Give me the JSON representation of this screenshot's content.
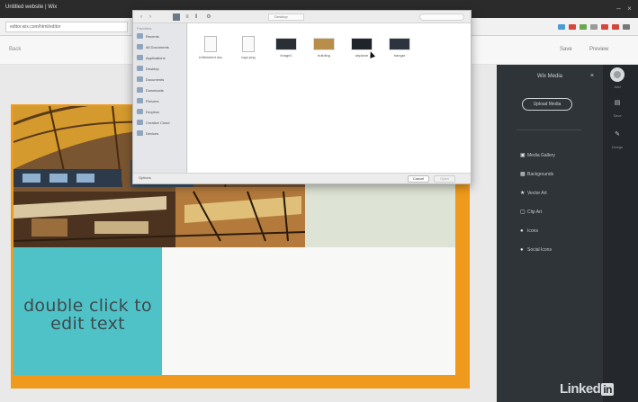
{
  "browser": {
    "window_title": "Untitled website | Wix",
    "url": "editor.wix.com/html/editor",
    "back": "Back",
    "toolbar_right": [
      "Save",
      "Preview"
    ]
  },
  "canvas": {
    "placeholder_text": "double click to edit text",
    "colors": {
      "frame": "#ef9a1c",
      "text_block": "#4fc2c7",
      "green_block": "#dde3d5"
    }
  },
  "panel": {
    "title": "Wix Media",
    "button": "Upload Media",
    "items": [
      {
        "icon": "image-icon",
        "glyph": "▣",
        "label": "Media Gallery"
      },
      {
        "icon": "grid-icon",
        "glyph": "▦",
        "label": "Backgrounds"
      },
      {
        "icon": "star-icon",
        "glyph": "★",
        "label": "Vector Art"
      },
      {
        "icon": "frame-icon",
        "glyph": "▢",
        "label": "Clip Art"
      },
      {
        "icon": "pin-icon",
        "glyph": "●",
        "label": "Icons"
      },
      {
        "icon": "bullet-icon",
        "glyph": "●",
        "label": "Social Icons"
      }
    ]
  },
  "rail": [
    {
      "icon": "add-icon",
      "label": "Add"
    },
    {
      "icon": "save-icon",
      "label": "Save",
      "glyph": "▤"
    },
    {
      "icon": "brush-icon",
      "label": "Design",
      "glyph": "✎"
    }
  ],
  "logo": {
    "text": "Linked",
    "badge": "in"
  },
  "dialog": {
    "path": "Desktop",
    "favorites_header": "Favorites",
    "favorites": [
      "Recents",
      "All Documents",
      "Applications",
      "Desktop",
      "Documents",
      "Downloads",
      "Pictures",
      "Dropbox",
      "Creative Cloud",
      "Devices"
    ],
    "files": [
      {
        "name": "Unfinished doc",
        "kind": "doc"
      },
      {
        "name": "logo.png",
        "kind": "doc"
      },
      {
        "name": "image1",
        "kind": "img"
      },
      {
        "name": "building",
        "kind": "img"
      },
      {
        "name": "airplane",
        "kind": "img"
      },
      {
        "name": "hangar",
        "kind": "img"
      }
    ],
    "options": "Options",
    "cancel": "Cancel",
    "open": "Open"
  }
}
